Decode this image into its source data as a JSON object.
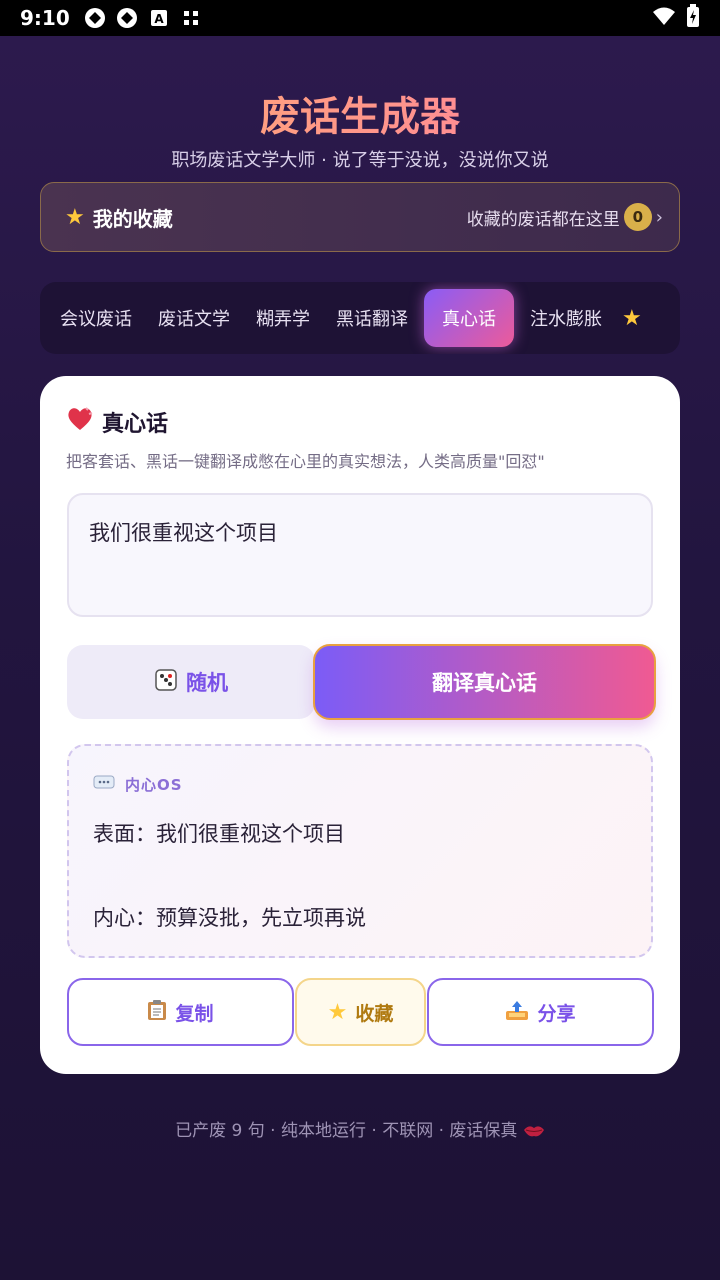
{
  "status": {
    "time": "9:10"
  },
  "header": {
    "title": "废话生成器",
    "subtitle": "职场废话文学大师 · 说了等于没说，没说你又说"
  },
  "favorites": {
    "title": "我的收藏",
    "hint": "收藏的废话都在这里",
    "count": "0",
    "star_color": "#ffc93c"
  },
  "tabs": [
    {
      "label": "会议废话"
    },
    {
      "label": "废话文学"
    },
    {
      "label": "糊弄学"
    },
    {
      "label": "黑话翻译"
    },
    {
      "label": "真心话",
      "active": true
    },
    {
      "label": "注水膨胀"
    }
  ],
  "card": {
    "title": "真心话",
    "description": "把客套话、黑话一键翻译成憋在心里的真实想法，人类高质量\"回怼\"",
    "input_value": "我们很重视这个项目",
    "random_label": "随机",
    "translate_label": "翻译真心话",
    "result": {
      "label": "内心OS",
      "surface": "表面：我们很重视这个项目",
      "inner": "内心：预算没批，先立项再说"
    },
    "actions": {
      "copy": "复制",
      "favorite": "收藏",
      "share": "分享"
    }
  },
  "footer": {
    "text": "已产废 9 句 · 纯本地运行 · 不联网 · 废话保真"
  },
  "colors": {
    "accent_purple": "#7b5cf7",
    "accent_pink": "#f05a92",
    "background": "#22153f"
  }
}
